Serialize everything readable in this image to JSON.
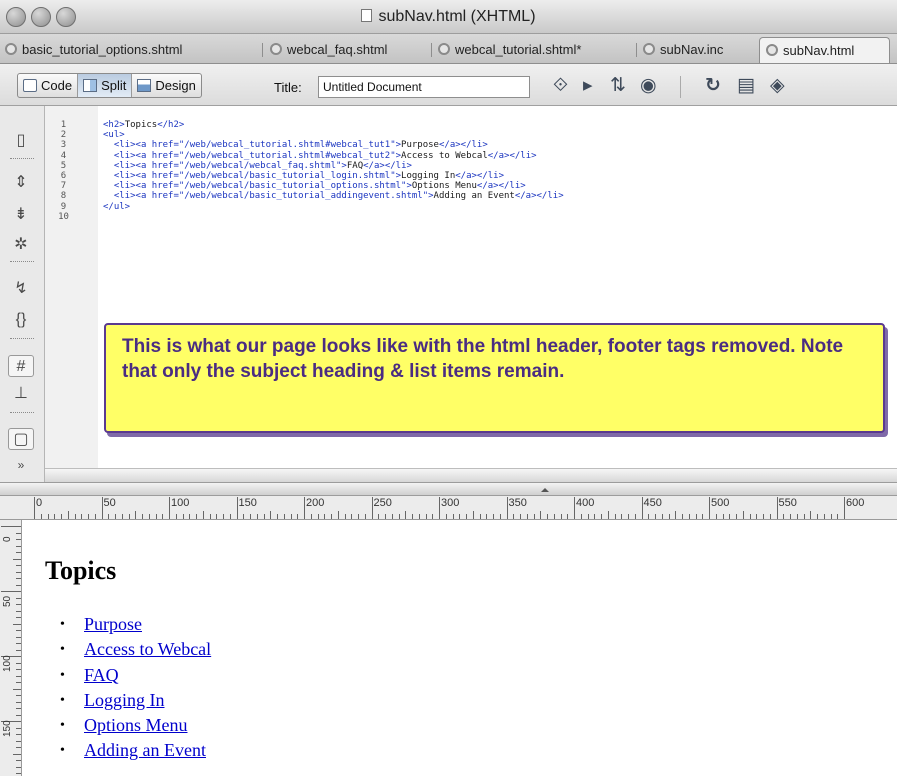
{
  "window": {
    "title": "subNav.html (XHTML)"
  },
  "tabs": [
    {
      "label": "basic_tutorial_options.shtml"
    },
    {
      "label": "webcal_faq.shtml"
    },
    {
      "label": "webcal_tutorial.shtml*"
    },
    {
      "label": "subNav.inc"
    },
    {
      "label": "subNav.html"
    }
  ],
  "toolbar": {
    "code_label": "Code",
    "split_label": "Split",
    "design_label": "Design",
    "title_label": "Title:",
    "title_value": "Untitled Document"
  },
  "code": {
    "line_numbers": [
      "1",
      "2",
      "3",
      "4",
      "5",
      "6",
      "7",
      "8",
      "9",
      "10"
    ],
    "lines": [
      "<h2>Topics</h2>",
      "<ul>",
      "  <li><a href=\"/web/webcal_tutorial.shtml#webcal_tut1\">Purpose</a></li>",
      "  <li><a href=\"/web/webcal_tutorial.shtml#webcal_tut2\">Access to Webcal</a></li>",
      "  <li><a href=\"/web/webcal/webcal_faq.shtml\">FAQ</a></li>",
      "  <li><a href=\"/web/webcal/basic_tutorial_login.shtml\">Logging In</a></li>",
      "  <li><a href=\"/web/webcal/basic_tutorial_options.shtml\">Options Menu</a></li>",
      "  <li><a href=\"/web/webcal/basic_tutorial_addingevent.shtml\">Adding an Event</a></li>",
      "</ul>",
      ""
    ]
  },
  "callout": {
    "text": "This is what our page looks like with the html header, footer tags removed. Note that only the subject heading & list items remain."
  },
  "ruler": {
    "labels": [
      "0",
      "50",
      "100",
      "150",
      "200",
      "250",
      "300",
      "350",
      "400",
      "450",
      "500",
      "550",
      "600"
    ],
    "vertical_labels": [
      "0",
      "50",
      "100",
      "150"
    ]
  },
  "design": {
    "heading": "Topics",
    "items": [
      "Purpose",
      "Access to Webcal",
      "FAQ",
      "Logging In",
      "Options Menu",
      "Adding an Event"
    ]
  },
  "colors": {
    "callout_bg": "#ffff66",
    "callout_text": "#4a2c82",
    "link": "#0000cc",
    "code_tag": "#1c36c0"
  }
}
